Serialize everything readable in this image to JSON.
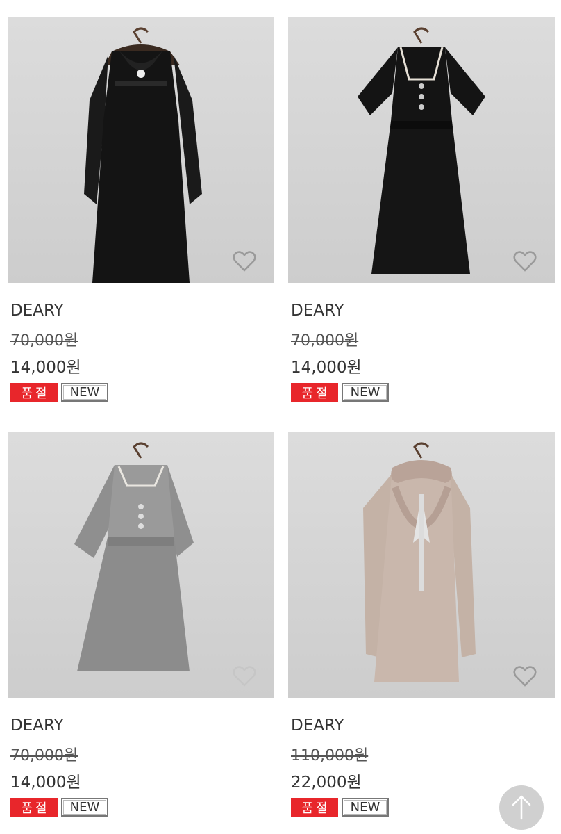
{
  "products": [
    {
      "brand": "DEARY",
      "original_price": "70,000원",
      "sale_price": "14,000원",
      "badge_soldout": "품절",
      "badge_new": "NEW",
      "garment_color": "#141414"
    },
    {
      "brand": "DEARY",
      "original_price": "70,000원",
      "sale_price": "14,000원",
      "badge_soldout": "품절",
      "badge_new": "NEW",
      "garment_color": "#141414"
    },
    {
      "brand": "DEARY",
      "original_price": "70,000원",
      "sale_price": "14,000원",
      "badge_soldout": "품절",
      "badge_new": "NEW",
      "garment_color": "#8f8f8f"
    },
    {
      "brand": "DEARY",
      "original_price": "110,000원",
      "sale_price": "22,000원",
      "badge_soldout": "품절",
      "badge_new": "NEW",
      "garment_color": "#c9b7ac"
    }
  ],
  "icons": {
    "wishlist": "heart-icon",
    "scroll_top": "arrow-up-icon"
  },
  "colors": {
    "soldout_badge": "#e8262b",
    "background": "#ffffff"
  }
}
